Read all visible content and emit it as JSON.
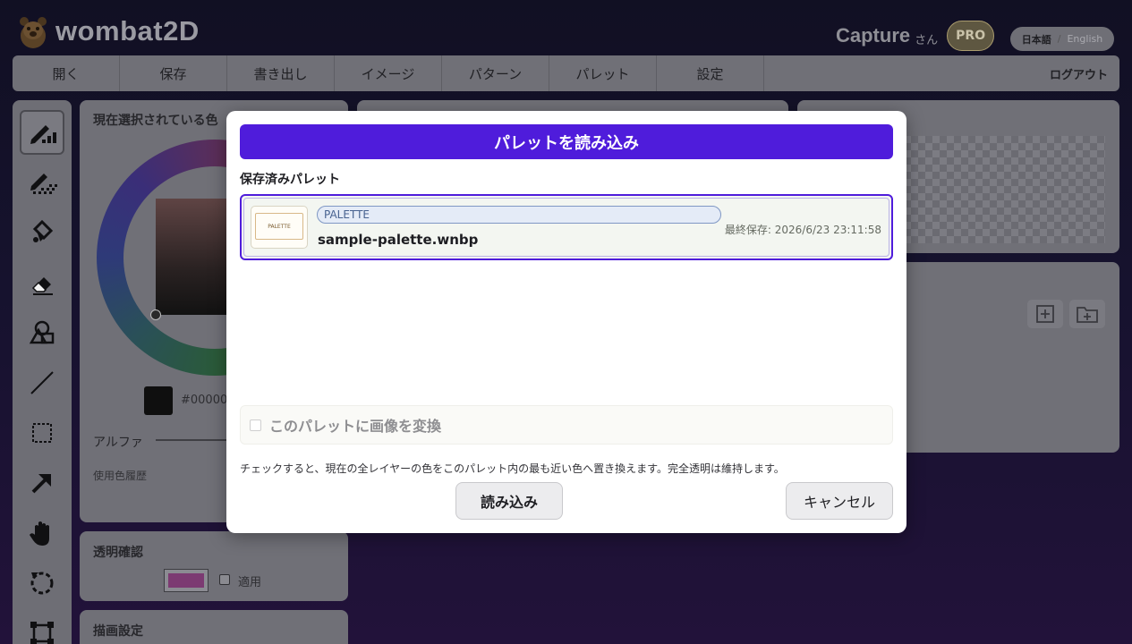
{
  "app": {
    "name": "wombat2D"
  },
  "user": {
    "name": "Capture",
    "suffix": "さん",
    "badge": "PRO"
  },
  "language": {
    "active": "日本語",
    "separator": "/",
    "other": "English"
  },
  "menu": {
    "items": [
      "開く",
      "保存",
      "書き出し",
      "イメージ",
      "パターン",
      "パレット",
      "設定"
    ],
    "logout": "ログアウト"
  },
  "tools": [
    "pen-icon",
    "dither-pen-icon",
    "fill-icon",
    "eraser-icon",
    "shape-icon",
    "line-icon",
    "select-rect-icon",
    "arrow-icon",
    "hand-icon",
    "rotate-icon",
    "transform-icon"
  ],
  "color_panel": {
    "title": "現在選択されている色",
    "hex_value": "#00000",
    "alpha_label": "アルファ",
    "history_label": "使用色履歴"
  },
  "transparency_panel": {
    "title": "透明確認",
    "apply_label": "適用",
    "color": "#a23a8e"
  },
  "draw_settings_panel": {
    "title": "描画設定"
  },
  "modal": {
    "title": "パレットを読み込み",
    "saved_label": "保存済みパレット",
    "files": [
      {
        "tag": "PALETTE",
        "name": "sample-palette.wnbp",
        "saved": "最終保存: 2026/6/23 23:11:58",
        "thumb_text": "PALETTE"
      }
    ],
    "convert_label": "このパレットに画像を変換",
    "hint": "チェックすると、現在の全レイヤーの色をこのパレット内の最も近い色へ置き換えます。完全透明は維持します。",
    "load_button": "読み込み",
    "cancel_button": "キャンセル"
  },
  "colors": {
    "accent": "#4f1cdb",
    "modal_bg": "#ffffff",
    "backdrop_panel": "#707077"
  }
}
